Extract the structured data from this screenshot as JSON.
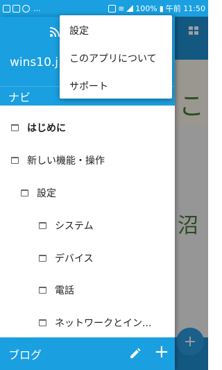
{
  "statusbar": {
    "dots": "...",
    "battery": "100%",
    "time": "午前 11:50"
  },
  "drawer": {
    "site_title": "wins10.j",
    "nav_header": "ナビ",
    "items": [
      {
        "label": "はじめに",
        "level": 0
      },
      {
        "label": "新しい機能・操作",
        "level": 0
      },
      {
        "label": "設定",
        "level": 1
      },
      {
        "label": "システム",
        "level": 2
      },
      {
        "label": "デバイス",
        "level": 2
      },
      {
        "label": "電話",
        "level": 2
      },
      {
        "label": "ネットワークとイン...",
        "level": 2
      }
    ],
    "bottom_label": "ブログ"
  },
  "popup_menu": {
    "items": [
      "設定",
      "このアプリについて",
      "サポート"
    ]
  },
  "background_page": {
    "banner_glyph_top": "こ",
    "banner_glyph_mid": "沼",
    "fab_label": "+"
  },
  "colors": {
    "primary": "#1a9fe0"
  }
}
